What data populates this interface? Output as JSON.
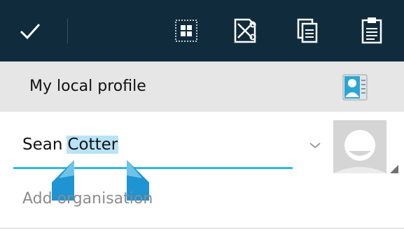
{
  "action_bar": {
    "done_icon": "checkmark-icon",
    "actions": [
      {
        "name": "select-all",
        "icon": "select-all-icon"
      },
      {
        "name": "cut",
        "icon": "cut-icon"
      },
      {
        "name": "copy",
        "icon": "copy-icon"
      },
      {
        "name": "paste",
        "icon": "paste-icon"
      }
    ]
  },
  "profile": {
    "title": "My local profile",
    "icon": "contact-card-icon"
  },
  "name_field": {
    "first": "Sean",
    "selected": "Cotter"
  },
  "organisation_field": {
    "placeholder": "Add organisation"
  },
  "colors": {
    "action_bar_bg": "#102b3c",
    "accent": "#33b5e5",
    "selection_highlight": "#b9e3f6",
    "profile_bar_bg": "#e6e6e6"
  }
}
